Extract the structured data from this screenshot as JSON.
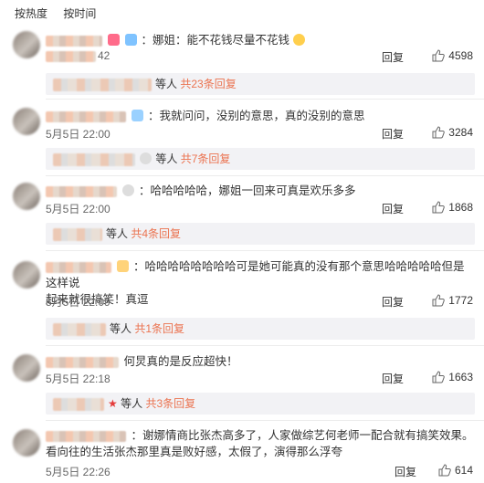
{
  "sort": {
    "hot": "按热度",
    "time": "按时间"
  },
  "comments": [
    {
      "text": "：娜姐：能不花钱尽量不花钱",
      "time": "42",
      "reply_label": "回复",
      "likes": "4598",
      "sub_tail": "等人",
      "sub_count": "共23条回复"
    },
    {
      "text": "：我就问问，没别的意思，真的没别的意思",
      "time": "5月5日 22:00",
      "reply_label": "回复",
      "likes": "3284",
      "sub_tail": "等人",
      "sub_count": "共7条回复"
    },
    {
      "text": "：哈哈哈哈哈，娜姐一回来可真是欢乐多多",
      "time": "5月5日 22:00",
      "reply_label": "回复",
      "likes": "1868",
      "sub_tail": "等人",
      "sub_count": "共4条回复"
    },
    {
      "text_line1": "：哈哈哈哈哈哈哈哈可是她可能真的没有那个意思哈哈哈哈哈但是这样说",
      "text_line2": "起来就很搞笑！真逗",
      "time": "5月5日 22:09",
      "reply_label": "回复",
      "likes": "1772",
      "sub_tail": "等人",
      "sub_count": "共1条回复"
    },
    {
      "text": "何炅真的是反应超快！",
      "time": "5月5日 22:18",
      "reply_label": "回复",
      "likes": "1663",
      "sub_tail": "等人",
      "sub_count": "共3条回复"
    },
    {
      "text_line1": "：谢娜情商比张杰高多了，人家做综艺何老师一配合就有搞笑效果。",
      "text_line2": "看向往的生活张杰那里真是败好感，太假了，演得那么浮夸",
      "time": "5月5日 22:26",
      "reply_label": "回复",
      "likes": "614"
    }
  ],
  "colors": {
    "accent": "#eb7350",
    "sub_bg": "#f2f2f5"
  }
}
